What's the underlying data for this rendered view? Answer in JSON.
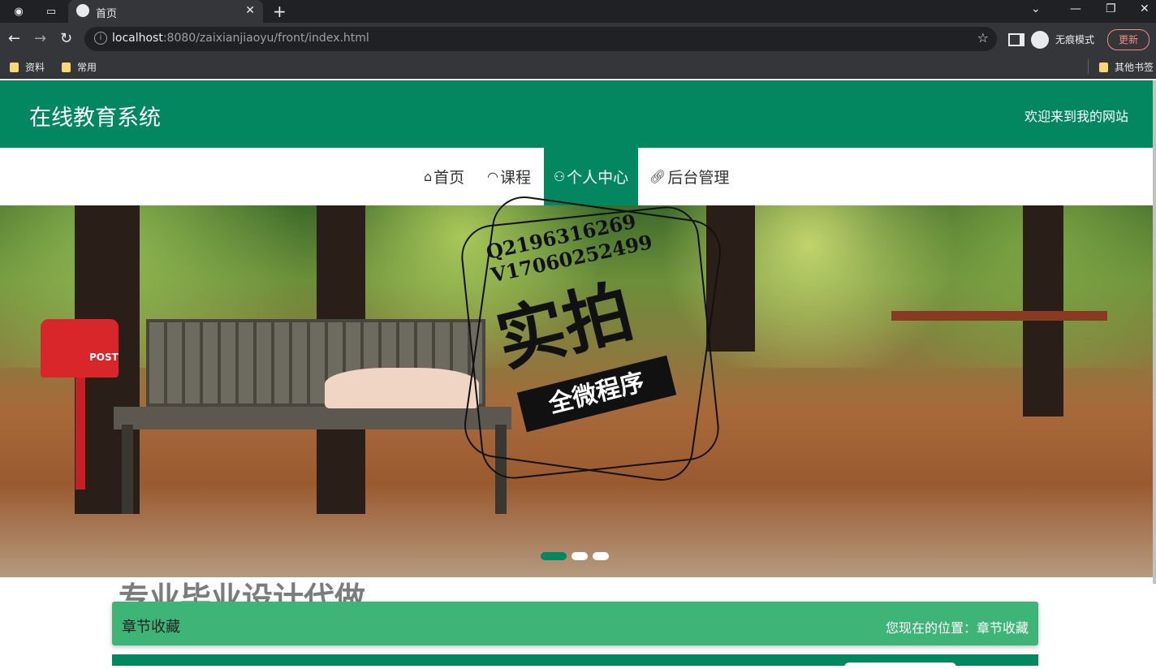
{
  "browser": {
    "tab_title": "首页",
    "url_host": "localhost",
    "url_rest": ":8080/zaixianjiaoyu/front/index.html",
    "incognito_label": "无痕模式",
    "update_label": "更新",
    "bookmarks": [
      "资料",
      "常用"
    ],
    "other_bookmarks": "其他书签"
  },
  "header": {
    "title": "在线教育系统",
    "welcome": "欢迎来到我的网站"
  },
  "nav": {
    "items": [
      {
        "label": "首页",
        "icon": "home-icon"
      },
      {
        "label": "课程",
        "icon": "dashboard-icon"
      },
      {
        "label": "个人中心",
        "icon": "user-icon",
        "active": true
      },
      {
        "label": "后台管理",
        "icon": "link-icon"
      }
    ]
  },
  "banner": {
    "active_slide": 1,
    "slide_count": 3,
    "watermark": {
      "qq": "Q2196316269",
      "vx": "V17060252499",
      "big": "实拍",
      "ribbon": "全微程序"
    },
    "mailbox_text": "POST"
  },
  "promo_text": "专业毕业设计代做",
  "breadcrumb": {
    "title": "章节收藏",
    "location": "您现在的位置：章节收藏"
  },
  "colors": {
    "primary": "#028760",
    "breadcrumb_bg": "#3fb477"
  }
}
